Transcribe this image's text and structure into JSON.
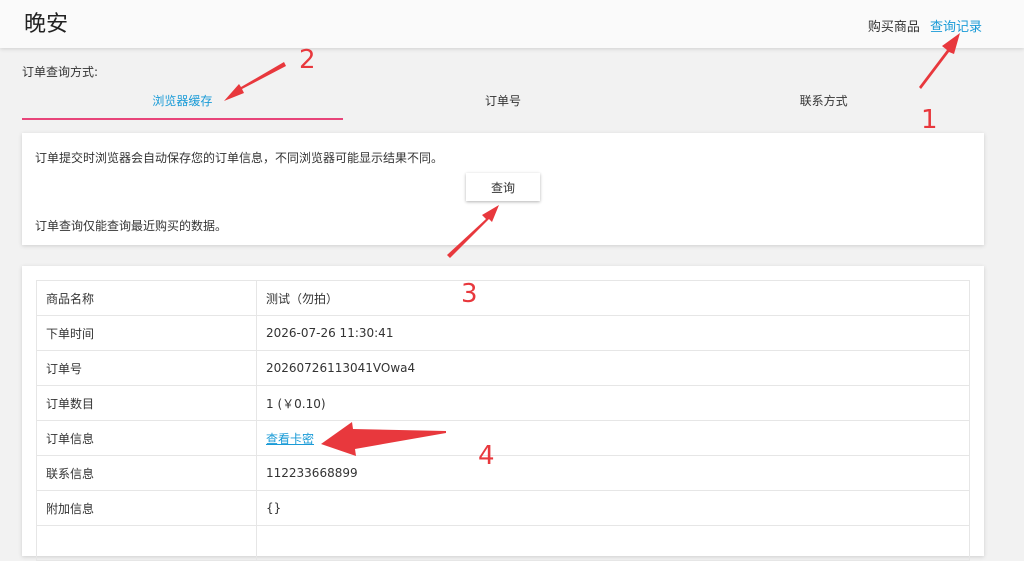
{
  "header": {
    "brand": "晚安",
    "nav": [
      "购买商品",
      "查询记录"
    ]
  },
  "query": {
    "method_label": "订单查询方式:",
    "tabs": [
      "浏览器缓存",
      "订单号",
      "联系方式"
    ],
    "active_tab": 0,
    "desc": "订单提交时浏览器会自动保存您的订单信息，不同浏览器可能显示结果不同。",
    "button": "查询",
    "note": "订单查询仅能查询最近购买的数据。"
  },
  "order": {
    "rows": [
      {
        "key": "商品名称",
        "value": "测试（勿拍）"
      },
      {
        "key": "下单时间",
        "value": "2026-07-26 11:30:41"
      },
      {
        "key": "订单号",
        "value": "20260726113041VOwa4"
      },
      {
        "key": "订单数目",
        "value": "1 (￥0.10)"
      },
      {
        "key": "订单信息",
        "value": "查看卡密"
      },
      {
        "key": "联系信息",
        "value": "112233668899"
      },
      {
        "key": "附加信息",
        "value": "{}"
      }
    ]
  },
  "annotations": {
    "labels": [
      "1",
      "2",
      "3",
      "4"
    ],
    "color": "#e8383d"
  }
}
